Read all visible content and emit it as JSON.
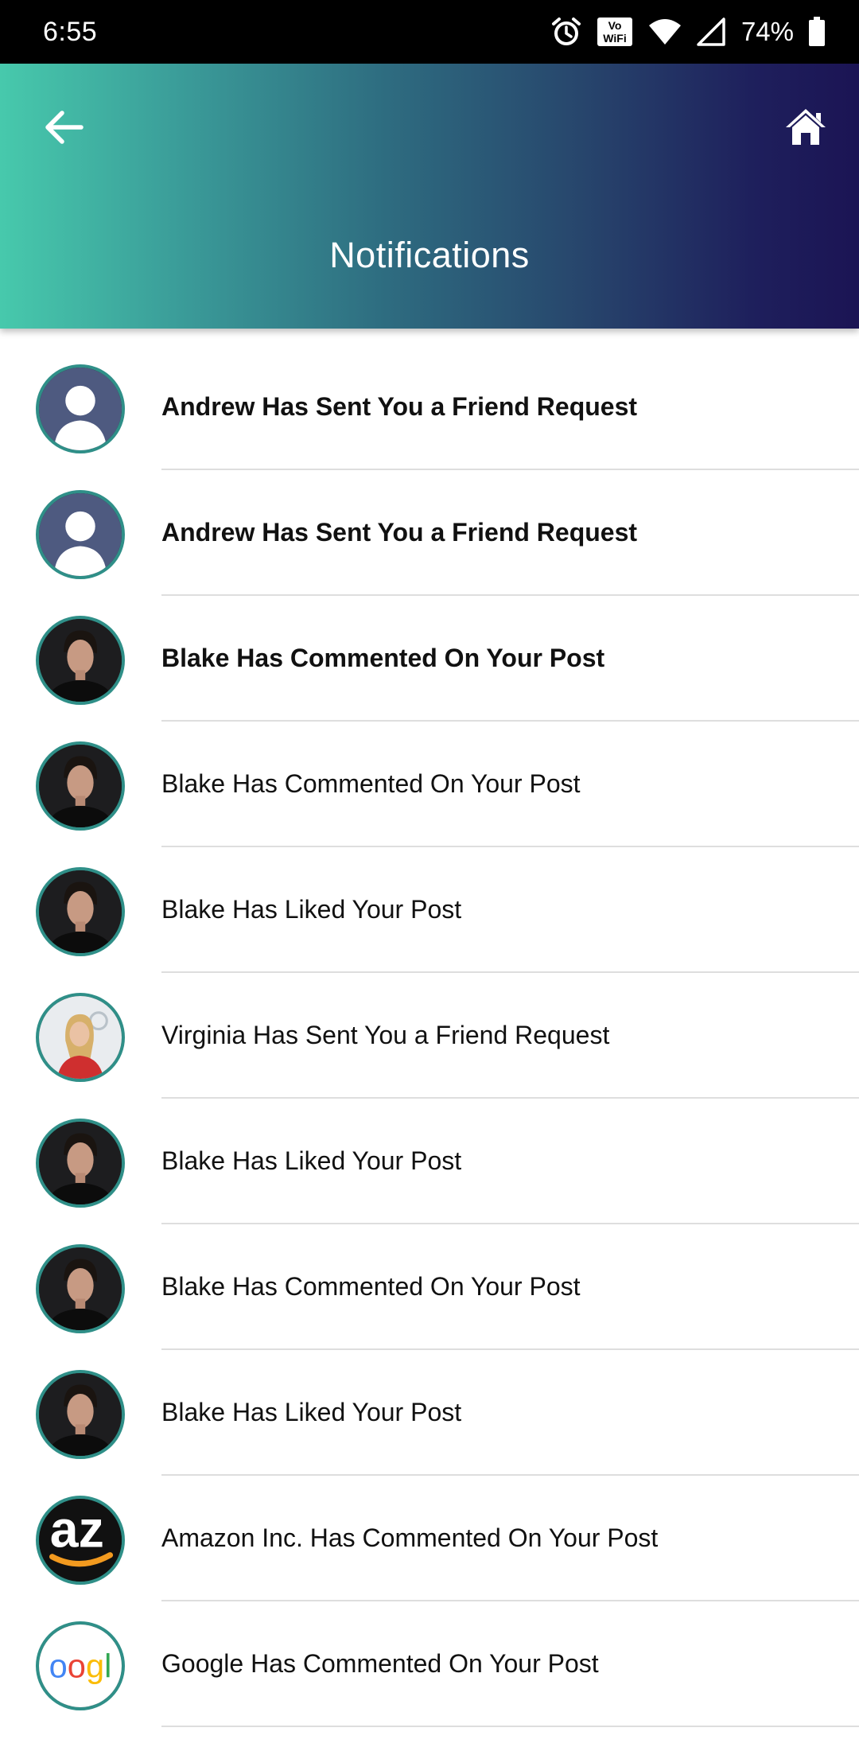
{
  "status_bar": {
    "time": "6:55",
    "battery": "74%",
    "icons": [
      "alarm-icon",
      "vowifi-icon",
      "wifi-icon",
      "signal-icon",
      "battery-icon"
    ]
  },
  "header": {
    "title": "Notifications",
    "back_icon": "arrow-left-icon",
    "home_icon": "home-icon",
    "gradient": [
      "#47c9ac",
      "#1b1454"
    ]
  },
  "notifications": [
    {
      "text": "Andrew Has Sent You a Friend Request",
      "unread": true,
      "avatar": "placeholder"
    },
    {
      "text": "Andrew Has Sent You a Friend Request",
      "unread": true,
      "avatar": "placeholder"
    },
    {
      "text": "Blake Has Commented On Your Post",
      "unread": true,
      "avatar": "man"
    },
    {
      "text": "Blake Has Commented On Your Post",
      "unread": false,
      "avatar": "man"
    },
    {
      "text": "Blake Has Liked Your Post",
      "unread": false,
      "avatar": "man"
    },
    {
      "text": "Virginia Has Sent You a Friend Request",
      "unread": false,
      "avatar": "woman"
    },
    {
      "text": "Blake Has Liked Your Post",
      "unread": false,
      "avatar": "man"
    },
    {
      "text": "Blake Has Commented On Your Post",
      "unread": false,
      "avatar": "man"
    },
    {
      "text": "Blake Has Liked Your Post",
      "unread": false,
      "avatar": "man"
    },
    {
      "text": "Amazon Inc. Has Commented On Your Post",
      "unread": false,
      "avatar": "amazon"
    },
    {
      "text": "Google Has Commented On Your Post",
      "unread": false,
      "avatar": "google"
    }
  ]
}
